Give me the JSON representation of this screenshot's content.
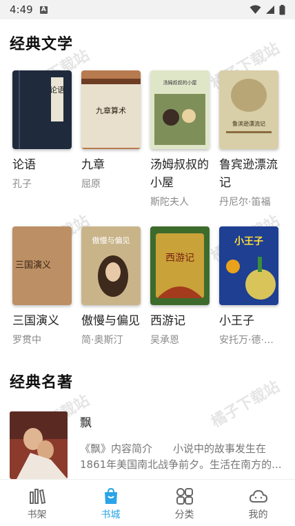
{
  "status_bar": {
    "time": "4:49",
    "notification_glyph": "A"
  },
  "sections": [
    {
      "title": "经典文学",
      "books": [
        {
          "title": "论语",
          "author": "孔子",
          "cover_label": "论语"
        },
        {
          "title": "九章",
          "author": "屈原",
          "cover_label": "九章算术"
        },
        {
          "title": "汤姆叔叔的小屋",
          "author": "斯陀夫人",
          "cover_label": "汤姆叔叔的小屋"
        },
        {
          "title": "鲁宾逊漂流记",
          "author": "丹尼尔·笛福",
          "cover_label": "鲁滨逊漂流记"
        },
        {
          "title": "三国演义",
          "author": "罗贯中",
          "cover_label": "三国演义"
        },
        {
          "title": "傲慢与偏见",
          "author": "简·奥斯汀",
          "cover_label": "傲慢与偏见"
        },
        {
          "title": "西游记",
          "author": "吴承恩",
          "cover_label": "西游记"
        },
        {
          "title": "小王子",
          "author": "安托万·德·圣埃克苏佩里",
          "cover_label": "小王子"
        }
      ]
    },
    {
      "title": "经典名著",
      "items": [
        {
          "title": "飘",
          "description": "《飘》内容简介　　小说中的故事发生在1861年美国南北战争前夕。生活在南方的..."
        }
      ]
    }
  ],
  "watermark_text": "橘子下载站",
  "tabs": [
    {
      "label": "书架",
      "icon": "bookshelf-icon",
      "active": false
    },
    {
      "label": "书城",
      "icon": "bookstore-bag-icon",
      "active": true
    },
    {
      "label": "分类",
      "icon": "category-grid-icon",
      "active": false
    },
    {
      "label": "我的",
      "icon": "profile-cloud-icon",
      "active": false
    }
  ],
  "colors": {
    "accent": "#2aa3e8",
    "inactive": "#666666",
    "author": "#888888"
  }
}
